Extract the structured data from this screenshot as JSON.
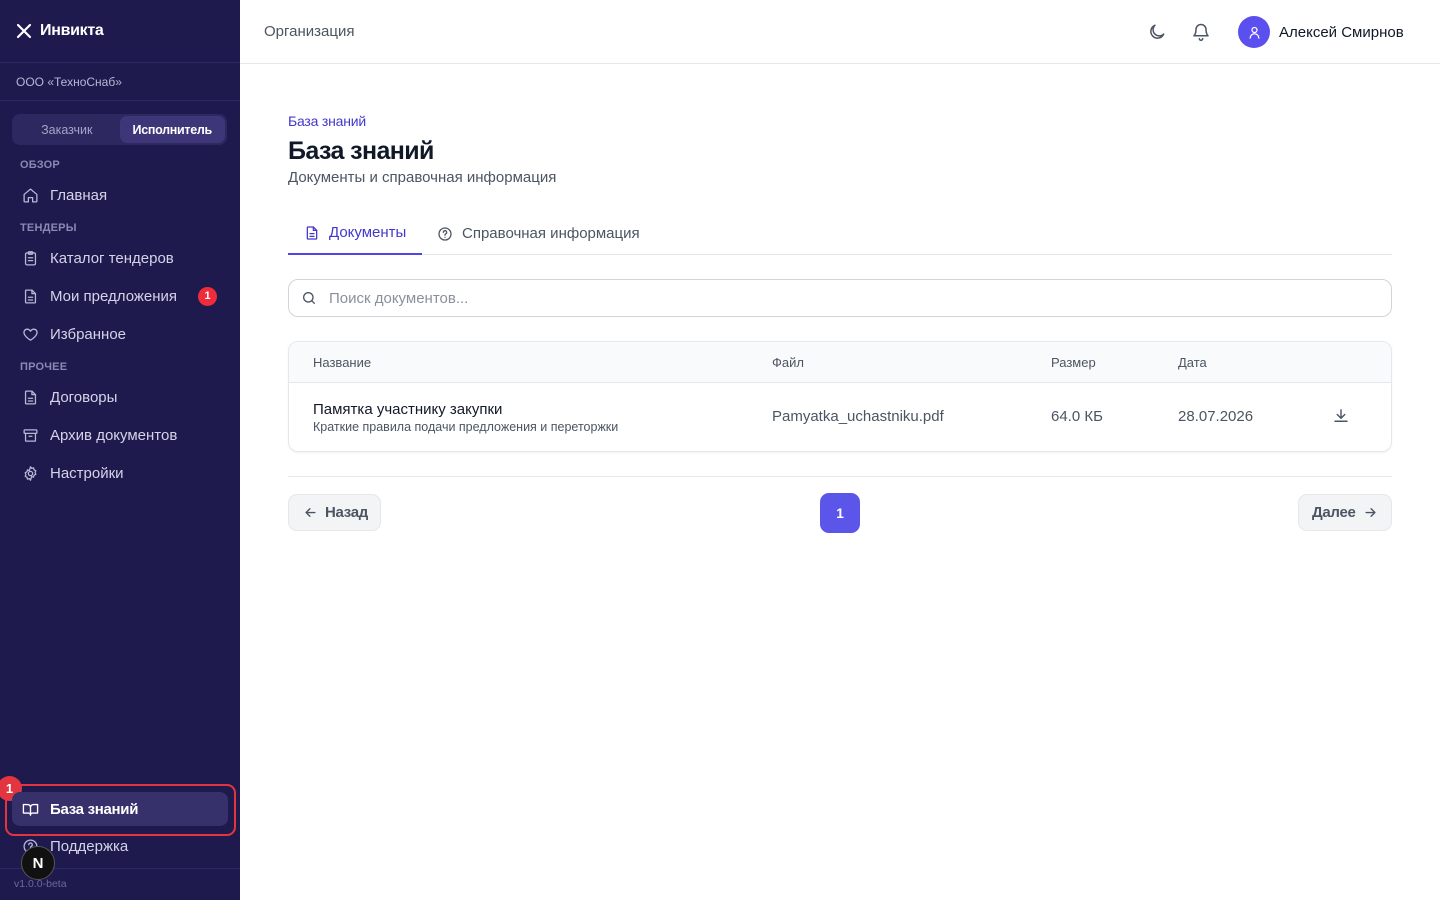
{
  "sidebar": {
    "brand": "Инвикта",
    "org": "ООО «ТехноСнаб»",
    "roles": [
      "Заказчик",
      "Исполнитель"
    ],
    "active_role": "Исполнитель",
    "sections": {
      "overview": "ОБЗОР",
      "tenders": "ТЕНДЕРЫ",
      "other": "ПРОЧЕЕ"
    },
    "items": {
      "home": "Главная",
      "catalog": "Каталог тендеров",
      "my_offers": "Мои предложения",
      "my_offers_badge": "1",
      "favorites": "Избранное",
      "contracts": "Договоры",
      "archive": "Архив документов",
      "settings": "Настройки",
      "knowledge": "База знаний",
      "support": "Поддержка"
    },
    "highlight_number": "1",
    "next_badge": "N",
    "version": "v1.0.0-beta"
  },
  "topbar": {
    "title": "Организация",
    "icons": [
      "moon-icon",
      "bell-icon"
    ],
    "user_name": "Алексей Смирнов"
  },
  "main": {
    "breadcrumb": "База знаний",
    "title": "База знаний",
    "subtitle": "Документы и справочная информация",
    "tabs": [
      "Документы",
      "Справочная информация"
    ],
    "active_tab": "Документы",
    "search_placeholder": "Поиск документов...",
    "table": {
      "headers": [
        "Название",
        "Файл",
        "Размер",
        "Дата"
      ],
      "rows": [
        {
          "title": "Памятка участнику закупки",
          "description": "Краткие правила подачи предложения и переторжки",
          "file": "Pamyatka_uchastniku.pdf",
          "size": "64.0 КБ",
          "date": "28.07.2026"
        }
      ]
    },
    "pagination": {
      "prev": "Назад",
      "page": "1",
      "next": "Далее"
    }
  },
  "colors": {
    "sidebar_bg": "#1f1a4d",
    "accent": "#5b55ea",
    "badge": "#ef2d3a",
    "highlight": "#e2353f"
  }
}
